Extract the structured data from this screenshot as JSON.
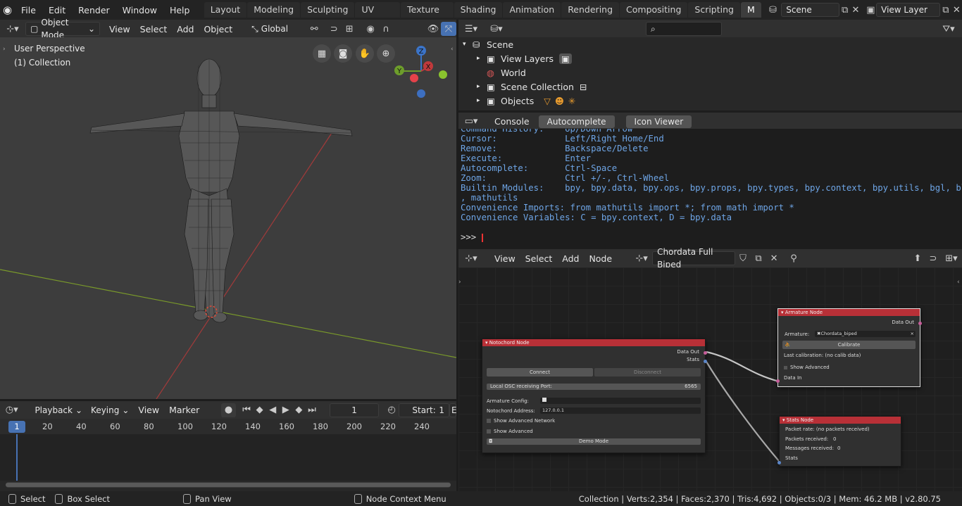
{
  "topbar": {
    "menus": [
      "File",
      "Edit",
      "Render",
      "Window",
      "Help"
    ],
    "workspaces": [
      "Layout",
      "Modeling",
      "Sculpting",
      "UV Editing",
      "Texture Paint",
      "Shading",
      "Animation",
      "Rendering",
      "Compositing",
      "Scripting",
      "M"
    ],
    "scene_name": "Scene",
    "view_layer_name": "View Layer"
  },
  "viewport": {
    "mode": "Object Mode",
    "menus": [
      "View",
      "Select",
      "Add",
      "Object"
    ],
    "transform": "Global",
    "overlay_title": "User Perspective",
    "overlay_collection": "(1) Collection",
    "gizmo_axes": [
      "Z",
      "X",
      "Y"
    ]
  },
  "outliner": {
    "search_placeholder": "",
    "items": [
      {
        "label": "Scene",
        "icon": "scene-icon"
      },
      {
        "label": "View Layers",
        "icon": "view-layer-icon"
      },
      {
        "label": "World",
        "icon": "world-icon"
      },
      {
        "label": "Scene Collection",
        "icon": "collection-icon"
      },
      {
        "label": "Objects",
        "icon": "objects-icon"
      }
    ]
  },
  "console": {
    "tabs": [
      "Console",
      "Autocomplete",
      "Icon Viewer"
    ],
    "lines": [
      "Command History:    Up/Down Arrow",
      "Cursor:             Left/Right Home/End",
      "Remove:             Backspace/Delete",
      "Execute:            Enter",
      "Autocomplete:       Ctrl-Space",
      "Zoom:               Ctrl +/-, Ctrl-Wheel",
      "Builtin Modules:    bpy, bpy.data, bpy.ops, bpy.props, bpy.types, bpy.context, bpy.utils, bgl, blf",
      ", mathutils",
      "Convenience Imports: from mathutils import *; from math import *",
      "Convenience Variables: C = bpy.context, D = bpy.data"
    ],
    "prompt": ">>> "
  },
  "node_editor": {
    "menus": [
      "View",
      "Select",
      "Add",
      "Node"
    ],
    "tree_name": "Chordata Full Biped",
    "notochord": {
      "title": "Notochord Node",
      "out_data": "Data Out",
      "out_stats": "Stats",
      "connect": "Connect",
      "disconnect": "Disconnect",
      "port_label": "Local OSC receiving Port:",
      "port_value": "6565",
      "armature_config": "Armature Config:",
      "address_label": "Notochord Address:",
      "address_value": "127.0.0.1",
      "adv_network": "Show Advanced Network",
      "adv": "Show Advanced",
      "demo": "Demo Mode"
    },
    "armature": {
      "title": "Armature Node",
      "out_data": "Data Out",
      "armature_label": "Armature:",
      "armature_value": "Chordata_biped",
      "calibrate": "Calibrate",
      "last_calib": "Last calibration: (no calib data)",
      "adv": "Show Advanced",
      "in_data": "Data In"
    },
    "stats": {
      "title": "Stats Node",
      "rate": "Packet rate: (no packets received)",
      "packets_label": "Packets received:",
      "packets_value": "0",
      "messages_label": "Messages received:",
      "messages_value": "0",
      "in_stats": "Stats"
    }
  },
  "timeline": {
    "menus": [
      "Playback",
      "Keying",
      "View",
      "Marker"
    ],
    "current_frame": "1",
    "start_label": "Start:",
    "start_value": "1",
    "end_partial": "E",
    "frame_badge": "1",
    "ticks": [
      "20",
      "40",
      "60",
      "80",
      "100",
      "120",
      "140",
      "160",
      "180",
      "200",
      "220",
      "240"
    ]
  },
  "statusbar": {
    "select": "Select",
    "box_select": "Box Select",
    "pan": "Pan View",
    "node_menu": "Node Context Menu",
    "stats": "Collection | Verts:2,354 | Faces:2,370 | Tris:4,692 | Objects:0/3 | Mem: 46.2 MB | v2.80.75"
  },
  "colors": {
    "accent": "#4772b3",
    "node_header": "#b83037",
    "console_text": "#6ea5e6"
  }
}
